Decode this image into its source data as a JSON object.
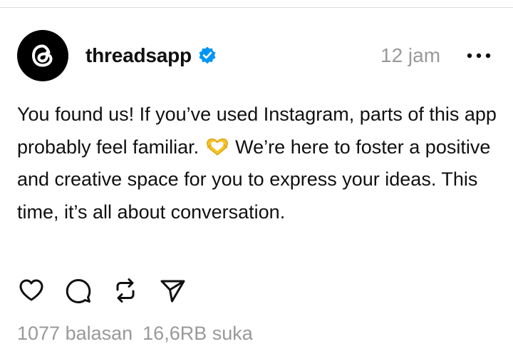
{
  "post": {
    "username": "threadsapp",
    "verified": true,
    "timestamp": "12 jam",
    "text_part1": "You found us! If you’ve used Instagram, parts of this app probably feel familiar.",
    "text_part2": "We’re here to foster a positive and creative space for you to express your ideas. This time, it’s all about conversation.",
    "emoji": "heart-hands",
    "icons": {
      "avatar": "threads-logo-icon",
      "verified": "verified-badge-icon",
      "more": "more-options-icon",
      "like": "heart-icon",
      "reply": "comment-icon",
      "repost": "repost-icon",
      "share": "send-icon"
    },
    "stats": {
      "replies": "1077 balasan",
      "likes": "16,6RB suka"
    },
    "colors": {
      "verified": "#0095F6",
      "text": "#101010",
      "muted": "#999999",
      "emoji": "#F7C325"
    }
  }
}
